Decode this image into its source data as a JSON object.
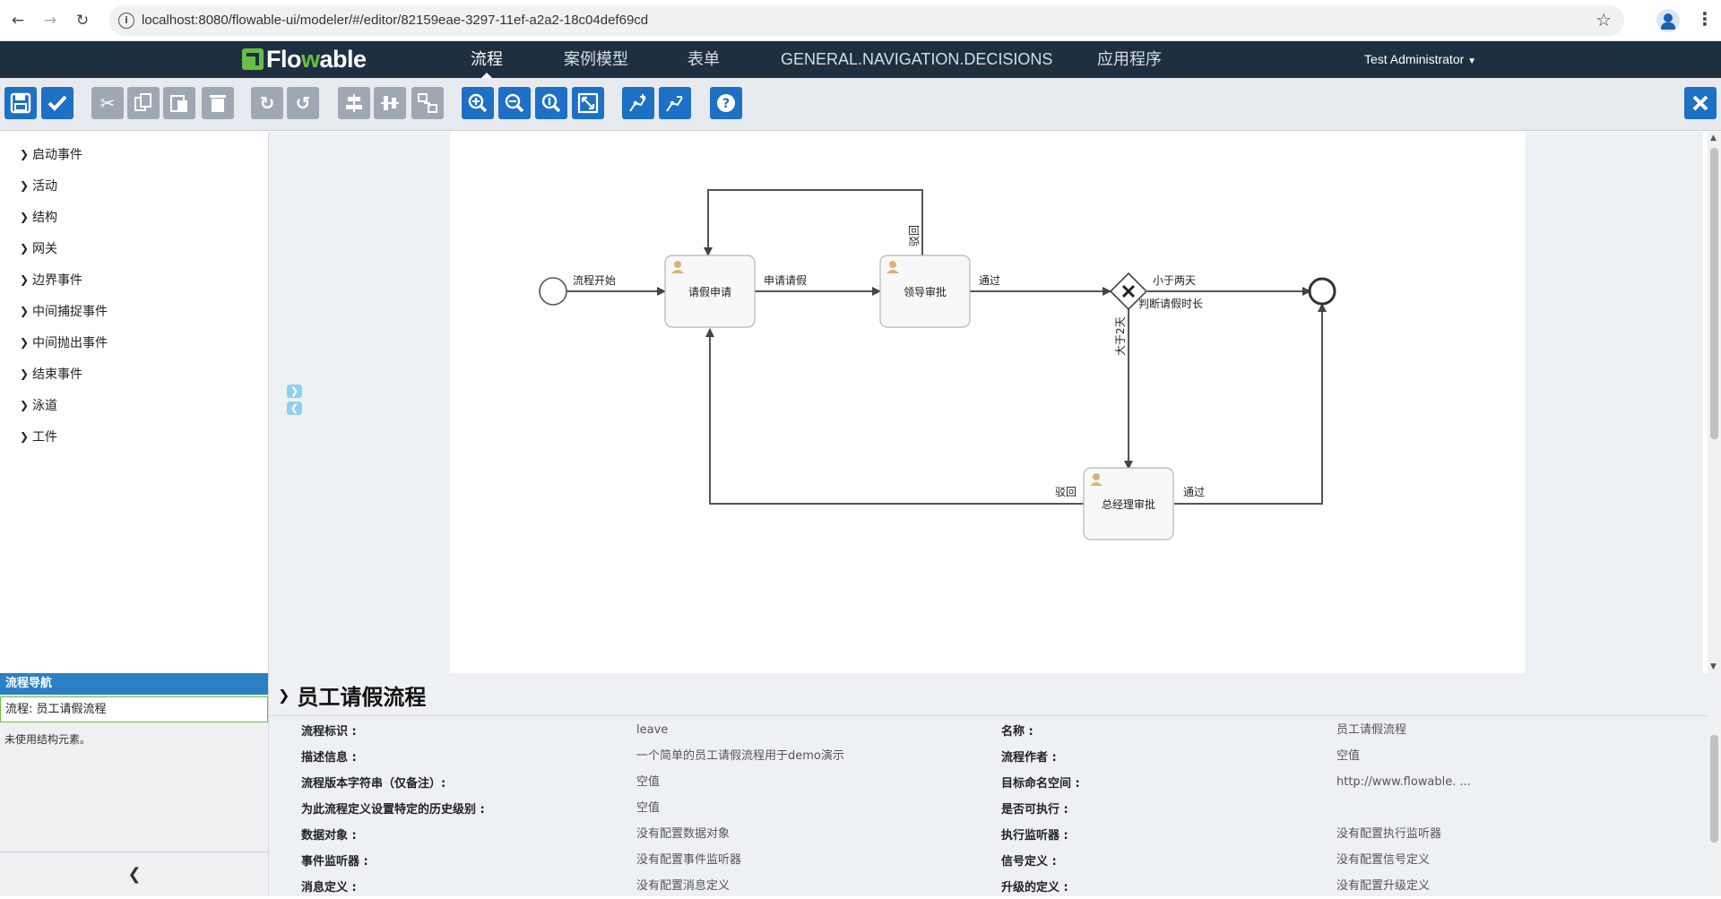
{
  "browser": {
    "url": "localhost:8080/flowable-ui/modeler/#/editor/82159eae-3297-11ef-a2a2-18c04def69cd"
  },
  "header": {
    "logo": "Flowable",
    "nav": [
      "流程",
      "案例模型",
      "表单",
      "GENERAL.NAVIGATION.DECISIONS",
      "应用程序"
    ],
    "active_nav": "流程",
    "user": "Test Administrator"
  },
  "toolbar": {
    "buttons": [
      "save",
      "validate",
      "cut",
      "copy",
      "paste",
      "delete",
      "redo",
      "undo",
      "align-horizontal",
      "align-vertical",
      "same-size",
      "zoom-in",
      "zoom-out",
      "zoom-actual",
      "zoom-fit",
      "bend-point-add",
      "bend-point-remove",
      "help",
      "close"
    ]
  },
  "palette": {
    "groups": [
      "启动事件",
      "活动",
      "结构",
      "网关",
      "边界事件",
      "中间捕捉事件",
      "中间抛出事件",
      "结束事件",
      "泳道",
      "工件"
    ]
  },
  "diagram": {
    "tasks": {
      "apply": "请假申请",
      "leader": "领导审批",
      "manager": "总经理审批"
    },
    "flows": {
      "start": "流程开始",
      "submit": "申请请假",
      "leader_pass": "通过",
      "reject_leader": "驳回",
      "less_two": "小于两天",
      "gateway": "判断请假时长",
      "more_two": "大于2天",
      "reject_manager": "驳回",
      "manager_pass": "通过"
    }
  },
  "navigation": {
    "header": "流程导航",
    "selected": "流程: 员工请假流程",
    "note": "未使用结构元素。"
  },
  "properties": {
    "title": "员工请假流程",
    "left": [
      {
        "label": "流程标识 :",
        "value": "leave"
      },
      {
        "label": "描述信息 :",
        "value": "一个简单的员工请假流程用于demo演示"
      },
      {
        "label": "流程版本字符串（仅备注）:",
        "value": "空值"
      },
      {
        "label": "为此流程定义设置特定的历史级别 :",
        "value": "空值"
      },
      {
        "label": "数据对象 :",
        "value": "没有配置数据对象"
      },
      {
        "label": "事件监听器 :",
        "value": "没有配置事件监听器"
      },
      {
        "label": "消息定义 :",
        "value": "没有配置消息定义"
      }
    ],
    "right": [
      {
        "label": "名称 :",
        "value": "员工请假流程"
      },
      {
        "label": "流程作者 :",
        "value": "空值"
      },
      {
        "label": "目标命名空间 :",
        "value": "http://www.flowable. ..."
      },
      {
        "label": "是否可执行 :",
        "value": ""
      },
      {
        "label": "执行监听器 :",
        "value": "没有配置执行监听器"
      },
      {
        "label": "信号定义 :",
        "value": "没有配置信号定义"
      },
      {
        "label": "升级的定义 :",
        "value": "没有配置升级定义"
      }
    ]
  },
  "colors": {
    "header_bg": "#1e2f40",
    "toolbar_blue": "#1d70c4",
    "toolbar_gray": "#9fa8b2",
    "brand_green": "#6abd45",
    "nav_header": "#2a80c2"
  }
}
